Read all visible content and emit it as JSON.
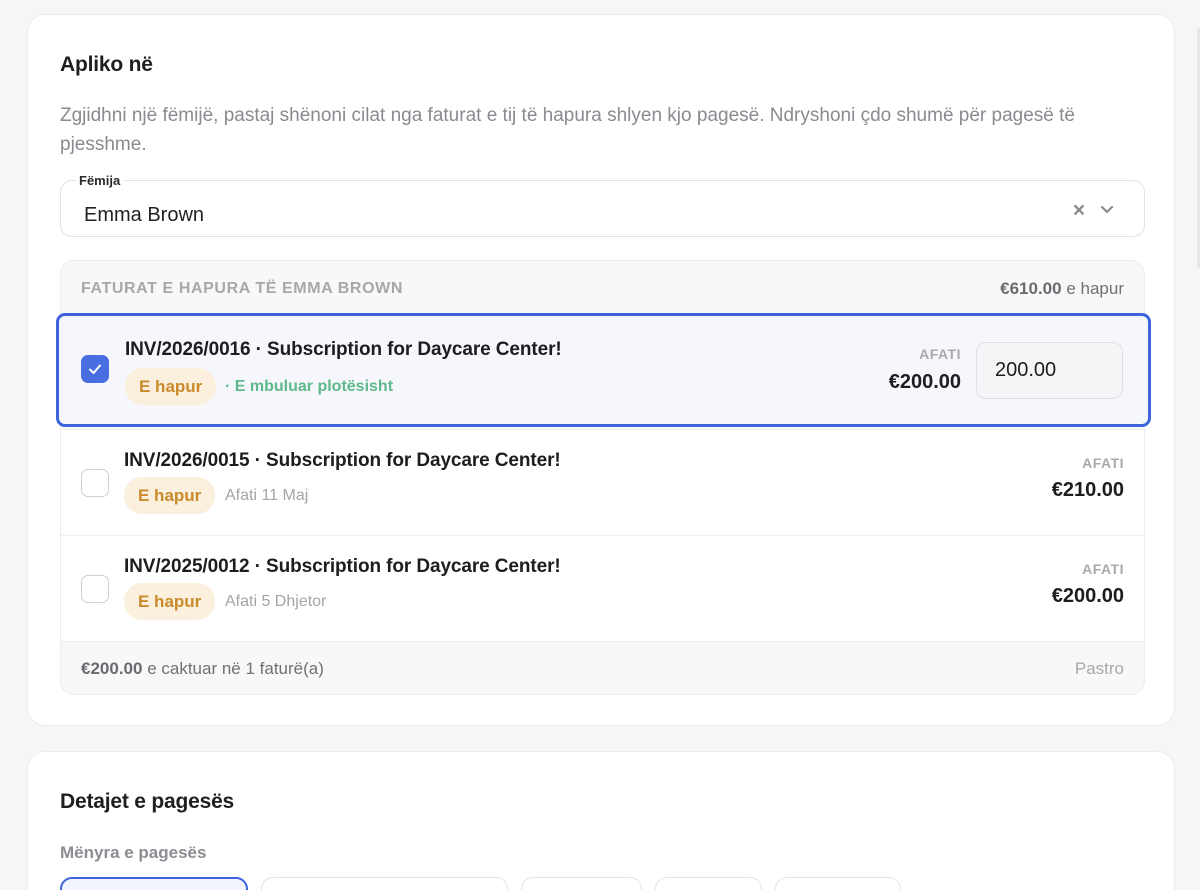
{
  "apply_section": {
    "title": "Apliko në",
    "description": "Zgjidhni një fëmijë, pastaj shënoni cilat nga faturat e tij të hapura shlyen kjo pagesë. Ndryshoni çdo shumë për pagesë të pjesshme.",
    "child_select": {
      "label": "Fëmija",
      "value": "Emma Brown"
    },
    "invoices_panel": {
      "header": "FATURAT E HAPURA TË EMMA BROWN",
      "total_amount": "€610.00",
      "total_suffix": "e hapur",
      "invoices": [
        {
          "title": "INV/2026/0016 · Subscription for Daycare Center!",
          "status": "E hapur",
          "note": "· E mbuluar plotësisht",
          "due_label": "AFATI",
          "amount": "€200.00",
          "applied_value": "200.00",
          "checked": true
        },
        {
          "title": "INV/2026/0015 · Subscription for Daycare Center!",
          "status": "E hapur",
          "note": "Afati 11 Maj",
          "due_label": "AFATI",
          "amount": "€210.00",
          "checked": false
        },
        {
          "title": "INV/2025/0012 · Subscription for Daycare Center!",
          "status": "E hapur",
          "note": "Afati 5 Dhjetor",
          "due_label": "AFATI",
          "amount": "€200.00",
          "checked": false
        }
      ],
      "footer": {
        "amount": "€200.00",
        "text": "e caktuar në 1 faturë(a)",
        "clear_label": "Pastro"
      }
    }
  },
  "payment_section": {
    "title": "Detajet e pagesës",
    "method_label": "Mënyra e pagesës"
  },
  "colors": {
    "accent": "#3d63dd",
    "status_open_bg": "#fbf0dd",
    "status_open_text": "#c98b2c",
    "covered_text": "#5fb98a"
  },
  "icons": {
    "clear": "close-icon",
    "dropdown": "chevron-down-icon",
    "checkbox": "check-icon"
  }
}
